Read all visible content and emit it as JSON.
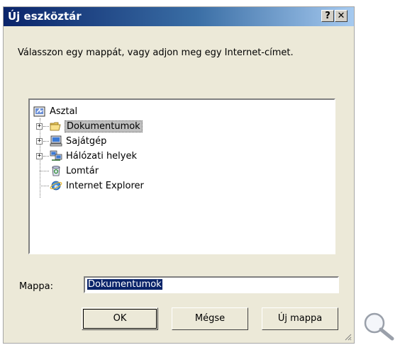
{
  "window": {
    "title": "Új eszköztár",
    "help_label": "?",
    "close_label": "✕"
  },
  "instruction": "Válasszon egy mappát, vagy adjon meg egy Internet-címet.",
  "tree": {
    "items": [
      {
        "label": "Asztal",
        "icon": "desktop-icon",
        "expandable": false
      },
      {
        "label": "Dokumentumok",
        "icon": "folder-open-icon",
        "expandable": true,
        "selected": true
      },
      {
        "label": "Sajátgép",
        "icon": "computer-icon",
        "expandable": true
      },
      {
        "label": "Hálózati helyek",
        "icon": "network-icon",
        "expandable": true
      },
      {
        "label": "Lomtár",
        "icon": "recycle-bin-icon",
        "expandable": false
      },
      {
        "label": "Internet Explorer",
        "icon": "ie-icon",
        "expandable": false
      }
    ],
    "expander_symbol": "+"
  },
  "folder_field": {
    "label": "Mappa:",
    "value": "Dokumentumok"
  },
  "buttons": {
    "ok": "OK",
    "cancel": "Mégse",
    "new_folder": "Új mappa"
  },
  "colors": {
    "title_gradient_start": "#0a246a",
    "selection": "#0a246a",
    "dialog_bg": "#ece9d8"
  }
}
